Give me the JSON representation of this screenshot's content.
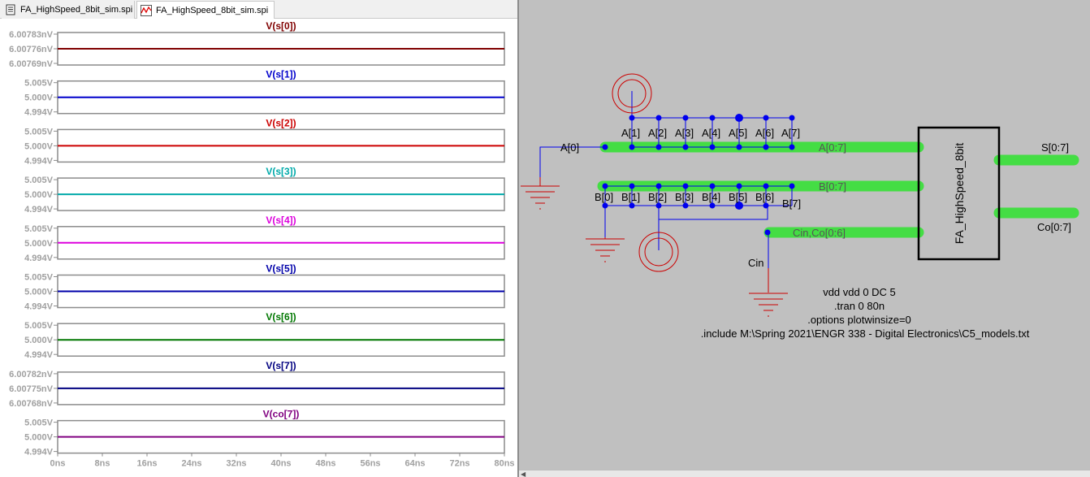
{
  "tabs": [
    {
      "label": "FA_HighSpeed_8bit_sim.spi",
      "icon": "netlist-icon",
      "active": false
    },
    {
      "label": "FA_HighSpeed_8bit_sim.spi",
      "icon": "waveform-icon",
      "active": true
    }
  ],
  "chart_data": {
    "type": "line",
    "x_ticks": [
      "0ns",
      "8ns",
      "16ns",
      "24ns",
      "32ns",
      "40ns",
      "48ns",
      "56ns",
      "64ns",
      "72ns",
      "80ns"
    ],
    "xlim": [
      0,
      80
    ],
    "grid": false,
    "panels": [
      {
        "title": "V(s[0])",
        "color": "#800000",
        "yticks": [
          "6.00783nV",
          "6.00776nV",
          "6.00769nV"
        ]
      },
      {
        "title": "V(s[1])",
        "color": "#0000cc",
        "yticks": [
          "5.005V",
          "5.000V",
          "4.994V"
        ]
      },
      {
        "title": "V(s[2])",
        "color": "#cc0000",
        "yticks": [
          "5.005V",
          "5.000V",
          "4.994V"
        ]
      },
      {
        "title": "V(s[3])",
        "color": "#00aaaa",
        "yticks": [
          "5.005V",
          "5.000V",
          "4.994V"
        ]
      },
      {
        "title": "V(s[4])",
        "color": "#dd00dd",
        "yticks": [
          "5.005V",
          "5.000V",
          "4.994V"
        ]
      },
      {
        "title": "V(s[5])",
        "color": "#0000aa",
        "yticks": [
          "5.005V",
          "5.000V",
          "4.994V"
        ]
      },
      {
        "title": "V(s[6])",
        "color": "#007700",
        "yticks": [
          "5.005V",
          "5.000V",
          "4.994V"
        ]
      },
      {
        "title": "V(s[7])",
        "color": "#000080",
        "yticks": [
          "6.00782nV",
          "6.00775nV",
          "6.00768nV"
        ]
      },
      {
        "title": "V(co[7])",
        "color": "#800080",
        "yticks": [
          "5.005V",
          "5.000V",
          "4.994V"
        ]
      }
    ]
  },
  "schematic": {
    "net_a0": "A[0]",
    "a_taps": [
      "A[1]",
      "A[2]",
      "A[3]",
      "A[4]",
      "A[5]",
      "A[6]",
      "A[7]"
    ],
    "b_taps": [
      "B[0]",
      "B[1]",
      "B[2]",
      "B[3]",
      "B[4]",
      "B[5]",
      "B[6]"
    ],
    "net_b7": "B[7]",
    "bus_a": "A[0:7]",
    "bus_b": "B[0:7]",
    "bus_cin": "Cin,Co[0:6]",
    "net_cin": "Cin",
    "block_name": "FA_HighSpeed_8bit",
    "out_s": "S[0:7]",
    "out_co": "Co[0:7]",
    "directives": [
      "vdd vdd 0 DC 5",
      ".tran 0 80n",
      ".options plotwinsize=0",
      ".include M:\\Spring 2021\\ENGR 338 - Digital Electronics\\C5_models.txt"
    ]
  }
}
